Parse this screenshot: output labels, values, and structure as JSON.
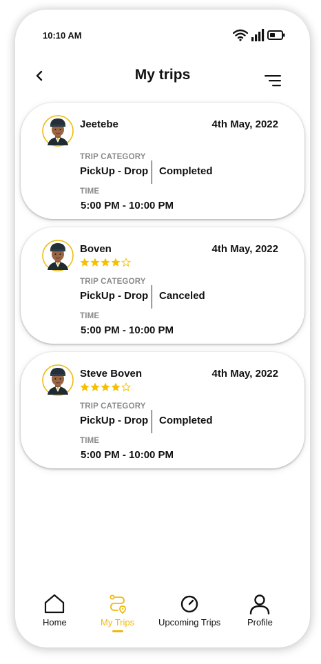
{
  "status_bar": {
    "time": "10:10 AM"
  },
  "header": {
    "title": "My trips"
  },
  "labels": {
    "trip_category": "TRIP CATEGORY",
    "time": "TIME"
  },
  "colors": {
    "accent": "#F0B90B",
    "star": "#F5C000",
    "text": "#111111",
    "muted": "#8a8a8a"
  },
  "trips": [
    {
      "driver": "Jeetebe",
      "date": "4th May, 2022",
      "rating": null,
      "category": "PickUp - Drop",
      "status": "Completed",
      "time": "5:00 PM - 10:00 PM"
    },
    {
      "driver": "Boven",
      "date": "4th May, 2022",
      "rating": 4,
      "category": "PickUp - Drop",
      "status": "Canceled",
      "time": "5:00 PM - 10:00 PM"
    },
    {
      "driver": "Steve Boven",
      "date": "4th May, 2022",
      "rating": 4,
      "category": "PickUp - Drop",
      "status": "Completed",
      "time": "5:00 PM - 10:00 PM"
    }
  ],
  "nav": {
    "items": [
      {
        "label": "Home",
        "icon": "home-icon",
        "active": false
      },
      {
        "label": "My Trips",
        "icon": "route-icon",
        "active": true
      },
      {
        "label": "Upcoming Trips",
        "icon": "clock-dial-icon",
        "active": false
      },
      {
        "label": "Profile",
        "icon": "person-icon",
        "active": false
      }
    ]
  }
}
